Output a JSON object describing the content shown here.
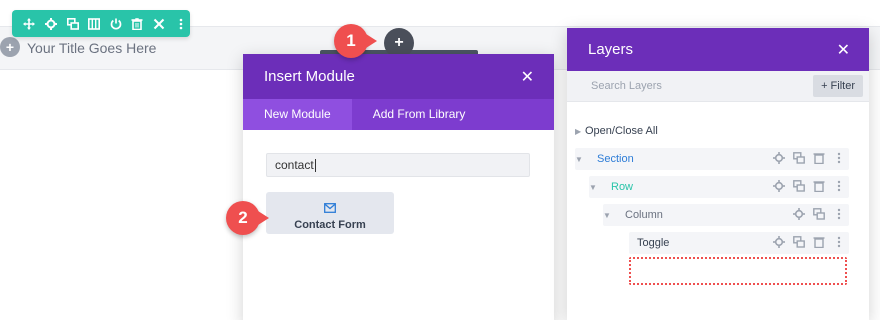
{
  "page": {
    "row_title": "Your Title Goes Here"
  },
  "toolbar": {
    "icons": [
      "move-icon",
      "gear-icon",
      "duplicate-icon",
      "columns-icon",
      "power-icon",
      "trash-icon",
      "close-icon",
      "more-icon"
    ]
  },
  "steps": {
    "one": "1",
    "two": "2"
  },
  "insert_module": {
    "title": "Insert Module",
    "tabs": [
      {
        "label": "New Module",
        "active": true
      },
      {
        "label": "Add From Library",
        "active": false
      }
    ],
    "search_value": "contact",
    "modules": [
      {
        "label": "Contact Form",
        "icon": "envelope-icon"
      }
    ]
  },
  "layers": {
    "title": "Layers",
    "search_placeholder": "Search Layers",
    "filter_label": "Filter",
    "open_close_all": "Open/Close All",
    "items": [
      {
        "label": "Section",
        "color": "#2e7dd7"
      },
      {
        "label": "Row",
        "color": "#29c4a9"
      },
      {
        "label": "Column",
        "color": "#6b7280"
      },
      {
        "label": "Toggle",
        "color": "#374151"
      }
    ]
  },
  "colors": {
    "purple_header": "#6c2eb9",
    "purple_tabs": "#7d3ccf",
    "green_toolbar": "#29c4a9",
    "step_red": "#ef4f4f"
  }
}
